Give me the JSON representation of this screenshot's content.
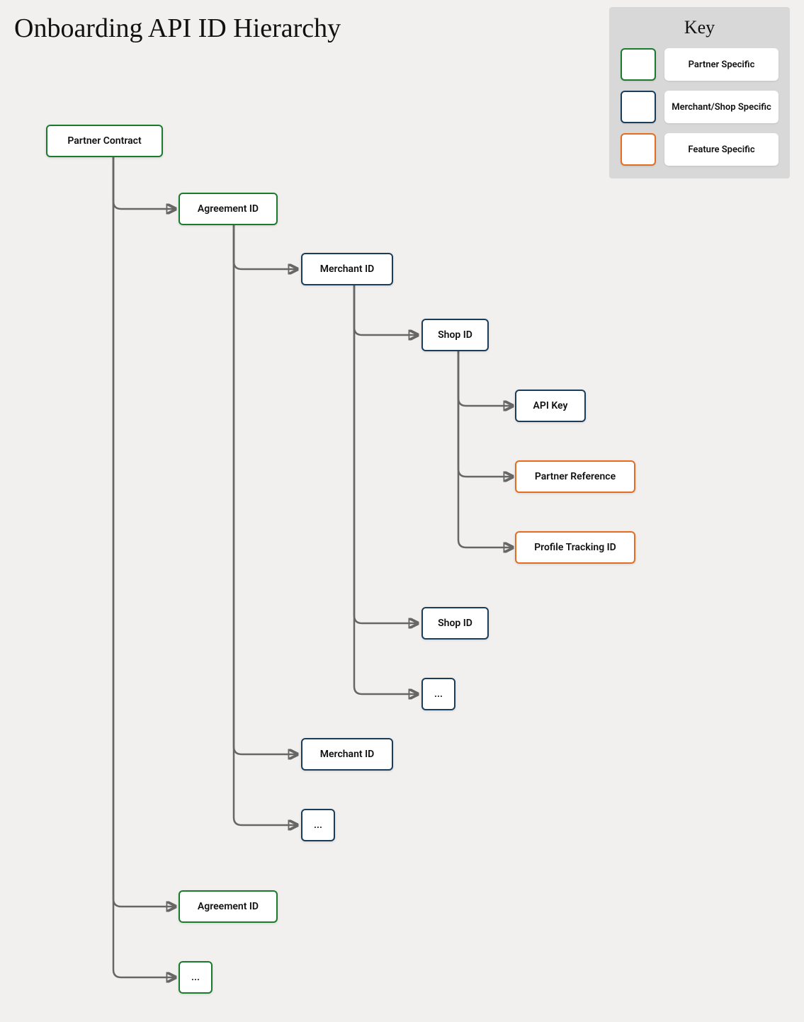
{
  "title": "Onboarding API ID Hierarchy",
  "legend": {
    "title": "Key",
    "items": [
      {
        "label": "Partner Specific",
        "variant": "partner"
      },
      {
        "label": "Merchant/Shop Specific",
        "variant": "merchant"
      },
      {
        "label": "Feature Specific",
        "variant": "feature"
      }
    ]
  },
  "colors": {
    "partner": "#1a7a2e",
    "merchant": "#1a3d5c",
    "feature": "#e46d1f",
    "connector": "#666666"
  },
  "nodes": {
    "partner_contract": {
      "label": "Partner Contract",
      "variant": "partner"
    },
    "agreement_id_1": {
      "label": "Agreement ID",
      "variant": "partner"
    },
    "merchant_id_1": {
      "label": "Merchant ID",
      "variant": "merchant"
    },
    "shop_id_1": {
      "label": "Shop ID",
      "variant": "merchant"
    },
    "api_key": {
      "label": "API Key",
      "variant": "merchant"
    },
    "partner_reference": {
      "label": "Partner Reference",
      "variant": "feature"
    },
    "profile_tracking": {
      "label": "Profile Tracking ID",
      "variant": "feature"
    },
    "shop_id_2": {
      "label": "Shop ID",
      "variant": "merchant"
    },
    "shop_more": {
      "label": "...",
      "variant": "merchant"
    },
    "merchant_id_2": {
      "label": "Merchant ID",
      "variant": "merchant"
    },
    "merchant_more": {
      "label": "...",
      "variant": "merchant"
    },
    "agreement_id_2": {
      "label": "Agreement ID",
      "variant": "partner"
    },
    "agreement_more": {
      "label": "...",
      "variant": "partner"
    }
  }
}
